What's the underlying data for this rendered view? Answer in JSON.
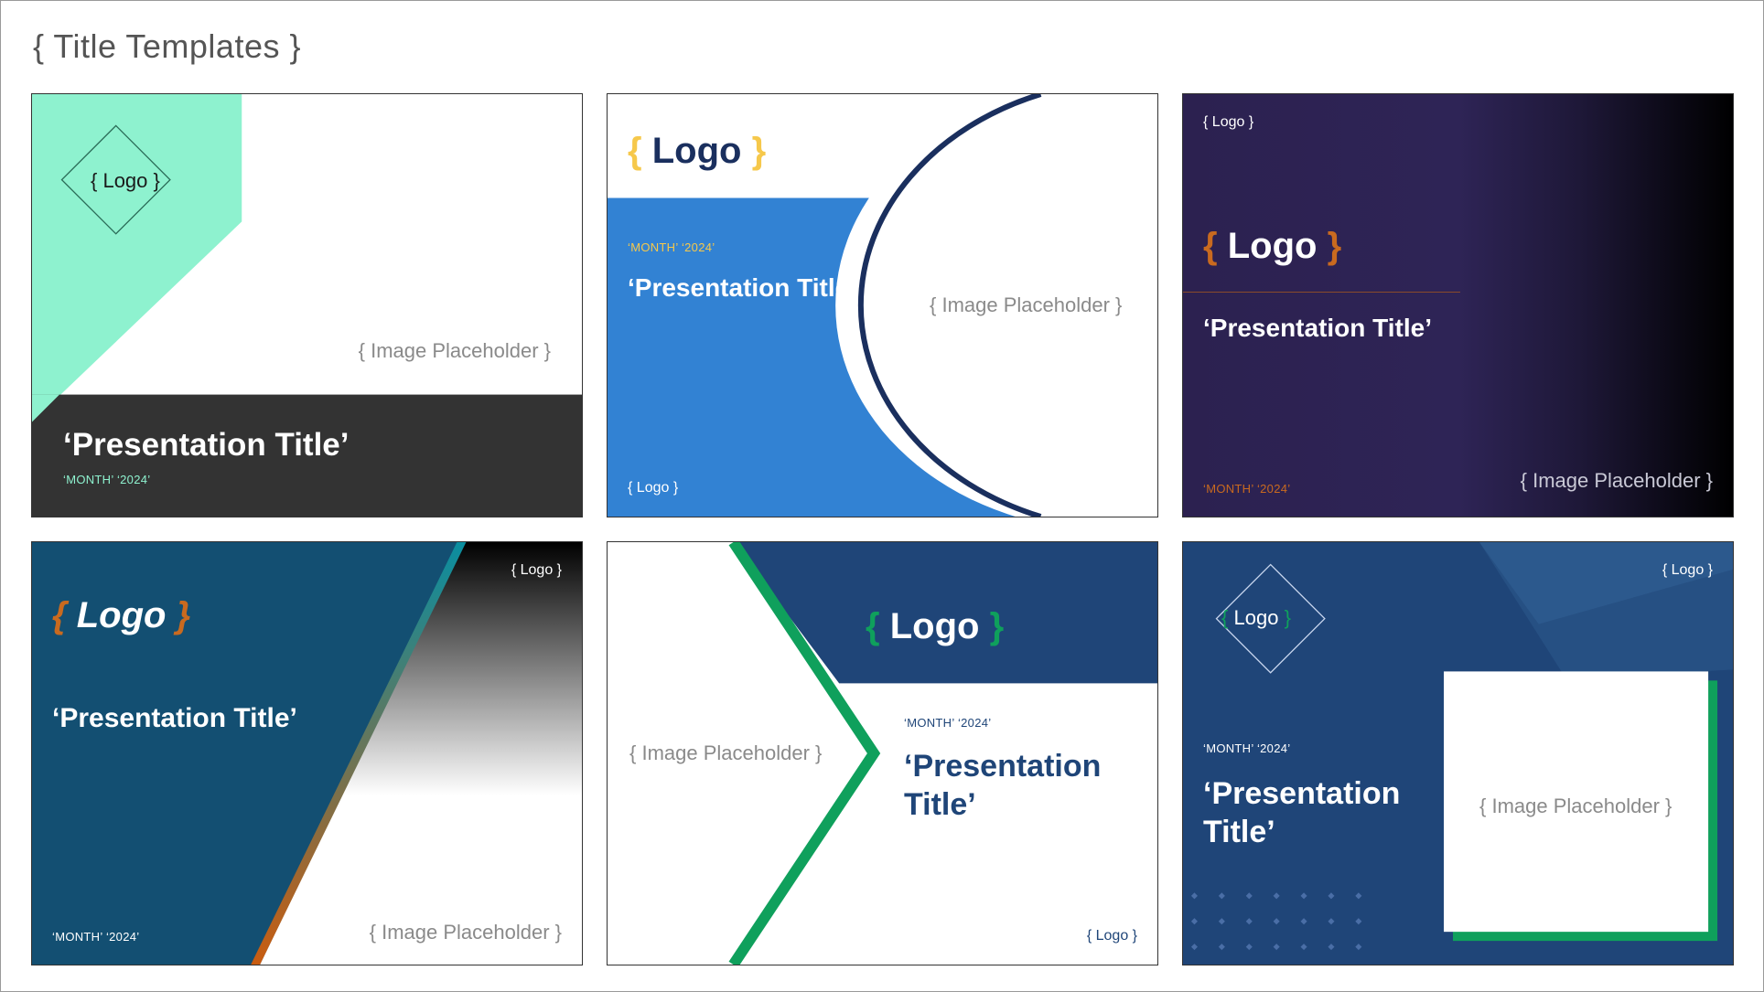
{
  "page": {
    "title": "{ Title Templates }"
  },
  "colors": {
    "mint": "#8ef2cf",
    "charcoal": "#333333",
    "blue": "#3282d3",
    "navy": "#1a2f5e",
    "purple": "#2c2150",
    "teal": "#134f72",
    "royal": "#1f4578",
    "green": "#0fa05c",
    "orange": "#c96a1f",
    "yellow": "#f6c84b"
  },
  "templates": [
    {
      "logo": "{ Logo }",
      "image_placeholder": "{ Image Placeholder }",
      "title": "‘Presentation Title’",
      "date": "‘MONTH’ ‘2024’"
    },
    {
      "logo_open": "{",
      "logo_word": "Logo",
      "logo_close": "}",
      "date": "‘MONTH’ ‘2024’",
      "title": "‘Presentation Title’",
      "image_placeholder": "{ Image Placeholder }",
      "footer_logo": "{ Logo }"
    },
    {
      "top_logo": "{ Logo }",
      "logo_open": "{",
      "logo_word": "Logo",
      "logo_close": "}",
      "title": "‘Presentation Title’",
      "date": "‘MONTH’ ‘2024’",
      "image_placeholder": "{ Image Placeholder }"
    },
    {
      "logo_open": "{",
      "logo_word": "Logo",
      "logo_close": "}",
      "corner_logo": "{ Logo }",
      "title": "‘Presentation Title’",
      "date": "‘MONTH’ ‘2024’",
      "image_placeholder": "{ Image Placeholder }"
    },
    {
      "logo_open": "{",
      "logo_word": "Logo",
      "logo_close": "}",
      "date": "‘MONTH’ ‘2024’",
      "title_line1": "‘Presentation",
      "title_line2": "Title’",
      "image_placeholder": "{ Image Placeholder }",
      "footer_logo": "{ Logo }"
    },
    {
      "diamond_logo_open": "{",
      "diamond_logo_word": "Logo",
      "diamond_logo_close": "}",
      "corner_logo": "{ Logo }",
      "date": "‘MONTH’ ‘2024’",
      "title_line1": "‘Presentation",
      "title_line2": "Title’",
      "image_placeholder": "{ Image Placeholder }"
    }
  ]
}
